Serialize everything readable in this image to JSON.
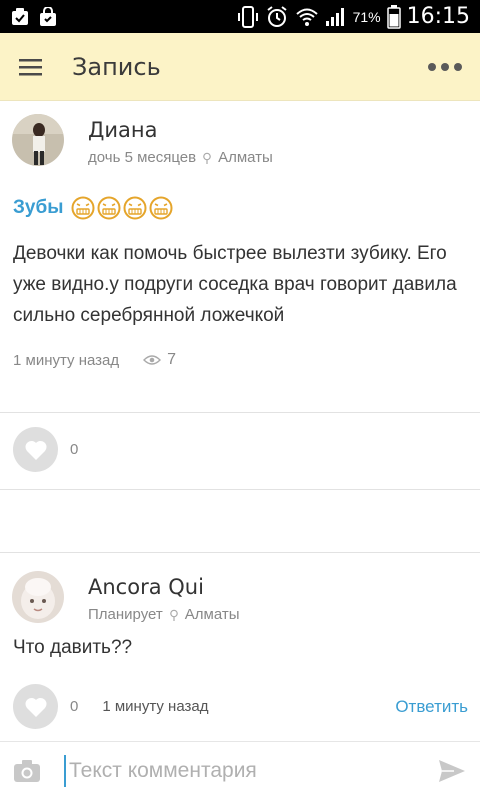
{
  "status_bar": {
    "battery_percent": "71%",
    "time": "16:15"
  },
  "app_bar": {
    "title": "Запись",
    "menu_icon": "hamburger-menu-icon",
    "more_icon": "more-dots-icon"
  },
  "post": {
    "author_name": "Диана",
    "author_child": "дочь 5 месяцев",
    "author_city": "Алматы",
    "title": "Зубы",
    "emoji_count": 4,
    "body": "Девочки как помочь быстрее вылезти зубику. Его уже видно.у подруги соседка врач говорит давила сильно серебрянной ложечкой",
    "time_ago": "1 минуту назад",
    "views": "7",
    "likes": "0"
  },
  "comment": {
    "author_name": "Ancora Qui",
    "author_status": "Планирует",
    "author_city": "Алматы",
    "text": "Что давить??",
    "likes": "0",
    "time_ago": "1 минуту назад",
    "reply_label": "Ответить"
  },
  "comment_input": {
    "placeholder": "Текст комментария"
  },
  "colors": {
    "app_bar_bg": "#fcf3c7",
    "accent_blue": "#3a9dd2",
    "like_button_bg": "#dedede"
  }
}
